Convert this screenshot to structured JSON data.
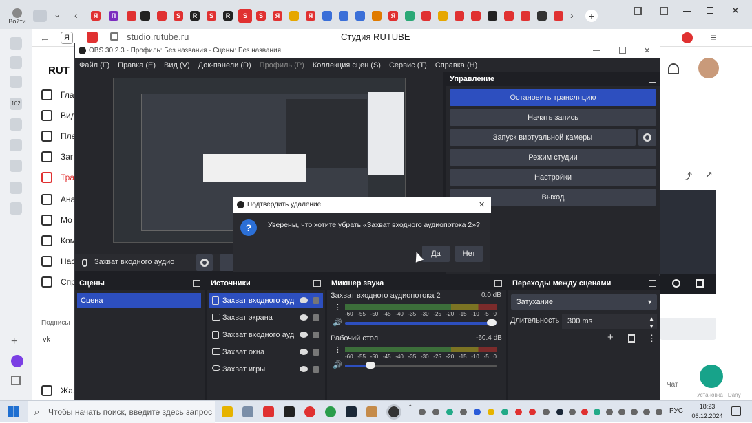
{
  "browser": {
    "profile_label": "Войти",
    "address": "studio.rutube.ru",
    "page_title": "Студия RUTUBE",
    "tab_icons": [
      "Я",
      "П",
      "S",
      "R",
      "S",
      "R",
      "S",
      "S",
      "Я",
      "Я",
      "Я"
    ],
    "rail_label": "102"
  },
  "rutube": {
    "logo": "RUT",
    "menu": [
      "Гла",
      "Вид",
      "Пле",
      "Заг",
      "Тра",
      "Ана",
      "Мо",
      "Ком",
      "Нас",
      "Спр"
    ],
    "subscriptions": "Подписы",
    "bottom": "Жал",
    "chat": "Чат",
    "footer_note": "Установка · Dany"
  },
  "obs": {
    "title": "OBS 30.2.3 - Профиль: Без названия - Сцены: Без названия",
    "menu": [
      "Файл (F)",
      "Правка (E)",
      "Вид (V)",
      "Док-панели (D)",
      "Профиль (P)",
      "Коллекция сцен (S)",
      "Сервис (T)",
      "Справка (H)"
    ],
    "source_bar_label": "Захват входного аудио",
    "controls": {
      "title": "Управление",
      "buttons": [
        "Остановить трансляцию",
        "Начать запись",
        "Запуск виртуальной камеры",
        "Режим студии",
        "Настройки",
        "Выход"
      ]
    },
    "scenes": {
      "title": "Сцены",
      "items": [
        "Сцена"
      ]
    },
    "sources": {
      "title": "Источники",
      "items": [
        "Захват входного ауд",
        "Захват экрана",
        "Захват входного ауд",
        "Захват окна",
        "Захват игры"
      ]
    },
    "mixer": {
      "title": "Микшер звука",
      "channels": [
        {
          "name": "Захват входного аудиопотока 2",
          "db": "0.0 dB",
          "volume": 1.0
        },
        {
          "name": "Рабочий стол",
          "db": "-60.4 dB",
          "volume": 0.2
        }
      ],
      "scale": [
        "-60",
        "-55",
        "-50",
        "-45",
        "-40",
        "-35",
        "-30",
        "-25",
        "-20",
        "-15",
        "-10",
        "-5",
        "0"
      ]
    },
    "transitions": {
      "title": "Переходы между сценами",
      "selected": "Затухание",
      "duration_label": "Длительность",
      "duration_value": "300 ms"
    }
  },
  "dialog": {
    "title": "Подтвердить удаление",
    "message": "Уверены, что хотите убрать «Захват входного аудиопотока 2»?",
    "yes": "Да",
    "no": "Нет"
  },
  "taskbar": {
    "search_placeholder": "Чтобы начать поиск, введите здесь запрос",
    "lang": "РУС",
    "time": "18:23",
    "date": "06.12.2024"
  },
  "colors": {
    "accent": "#2d4fbf",
    "obs_bg": "#1e1f24",
    "panel": "#26272c",
    "button": "#3c404b"
  }
}
